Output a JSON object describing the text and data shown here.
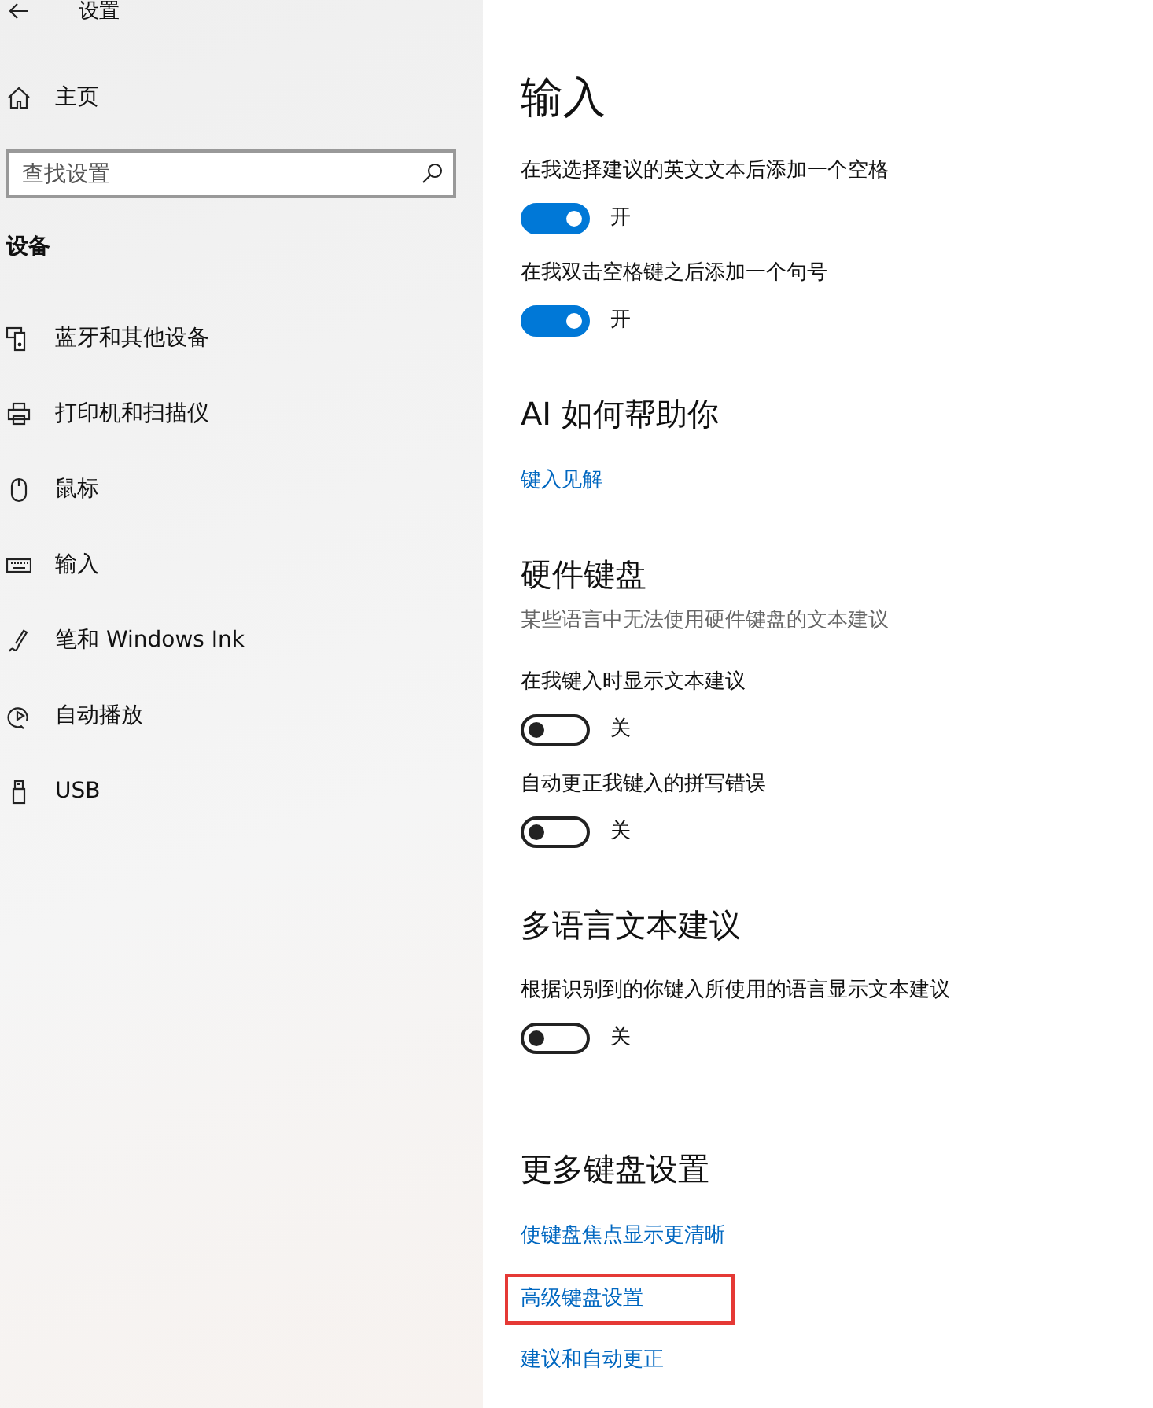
{
  "window": {
    "title": "设置"
  },
  "sidebar": {
    "home": "主页",
    "search": {
      "placeholder": "查找设置"
    },
    "group": "设备",
    "items": [
      {
        "label": "蓝牙和其他设备"
      },
      {
        "label": "打印机和扫描仪"
      },
      {
        "label": "鼠标"
      },
      {
        "label": "输入"
      },
      {
        "label": "笔和 Windows Ink"
      },
      {
        "label": "自动播放"
      },
      {
        "label": "USB"
      }
    ]
  },
  "sections": [
    {
      "heading": "输入",
      "kind": "page-title",
      "items": [
        {
          "kind": "label",
          "text": "在我选择建议的英文文本后添加一个空格"
        },
        {
          "kind": "toggle",
          "on": true,
          "text": "开"
        },
        {
          "kind": "label",
          "text": "在我双击空格键之后添加一个句号"
        },
        {
          "kind": "toggle",
          "on": true,
          "text": "开"
        }
      ]
    },
    {
      "heading": "AI 如何帮助你",
      "kind": "section",
      "items": [
        {
          "kind": "link",
          "text": "键入见解",
          "highlighted": false
        }
      ]
    },
    {
      "heading": "硬件键盘",
      "kind": "section",
      "items": [
        {
          "kind": "description",
          "text": "某些语言中无法使用硬件键盘的文本建议"
        },
        {
          "kind": "label",
          "text": "在我键入时显示文本建议"
        },
        {
          "kind": "toggle",
          "on": false,
          "text": "关"
        },
        {
          "kind": "label",
          "text": "自动更正我键入的拼写错误"
        },
        {
          "kind": "toggle",
          "on": false,
          "text": "关"
        }
      ]
    },
    {
      "heading": "多语言文本建议",
      "kind": "section",
      "items": [
        {
          "kind": "label",
          "text": "根据识别到的你键入所使用的语言显示文本建议"
        },
        {
          "kind": "toggle",
          "on": false,
          "text": "关"
        }
      ]
    },
    {
      "heading": "更多键盘设置",
      "kind": "section",
      "items": [
        {
          "kind": "link",
          "text": "使键盘焦点显示更清晰",
          "highlighted": false
        },
        {
          "kind": "link",
          "text": "高级键盘设置",
          "highlighted": true
        },
        {
          "kind": "link",
          "text": "建议和自动更正",
          "highlighted": false
        }
      ]
    }
  ]
}
